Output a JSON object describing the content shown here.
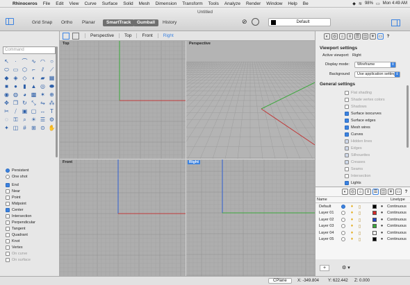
{
  "menubar": {
    "app": "Rhinoceros",
    "items": [
      "File",
      "Edit",
      "View",
      "Curve",
      "Surface",
      "Solid",
      "Mesh",
      "Dimension",
      "Transform",
      "Tools",
      "Analyze",
      "Render",
      "Window",
      "Help",
      "Be"
    ],
    "battery": "98%",
    "clock": "Mon 4:49 AM"
  },
  "window": {
    "title": "Untitled"
  },
  "toolbar": {
    "buttons": [
      "Grid Snap",
      "Ortho",
      "Planar",
      "SmartTrack",
      "Gumball",
      "History"
    ],
    "active": [
      "SmartTrack",
      "Gumball"
    ],
    "layer": "Default"
  },
  "command": {
    "placeholder": "Command"
  },
  "viewport_tabs": [
    "Perspective",
    "Top",
    "Front",
    "Right"
  ],
  "viewport_active": "Right",
  "viewports": [
    "Top",
    "Perspective",
    "Front",
    "Right"
  ],
  "osnap": {
    "mode": [
      {
        "label": "Persistent",
        "on": true
      },
      {
        "label": "One shot",
        "on": false
      }
    ],
    "items": [
      {
        "label": "End",
        "on": true
      },
      {
        "label": "Near",
        "on": false
      },
      {
        "label": "Point",
        "on": false
      },
      {
        "label": "Midpoint",
        "on": false
      },
      {
        "label": "Center",
        "on": true
      },
      {
        "label": "Intersection",
        "on": false
      },
      {
        "label": "Perpendicular",
        "on": false
      },
      {
        "label": "Tangent",
        "on": false
      },
      {
        "label": "Quadrant",
        "on": false
      },
      {
        "label": "Knot",
        "on": false
      },
      {
        "label": "Vertex",
        "on": false
      },
      {
        "label": "On curve",
        "on": false,
        "dim": true
      },
      {
        "label": "On surface",
        "on": false,
        "dim": true
      }
    ]
  },
  "viewport_settings": {
    "heading": "Viewport settings",
    "active_label": "Active viewport:",
    "active_value": "Right",
    "display_label": "Display mode:",
    "display_value": "Wireframe",
    "background_label": "Background",
    "background_value": "Use application settings"
  },
  "general_settings": {
    "heading": "General settings",
    "items": [
      {
        "label": "Flat shading",
        "on": false,
        "dim": true
      },
      {
        "label": "Shade vertex colors",
        "on": false,
        "dim": true
      },
      {
        "label": "Shadows",
        "on": false,
        "dim": true
      },
      {
        "label": "Surface isocurves",
        "on": true
      },
      {
        "label": "Surface edges",
        "on": true
      },
      {
        "label": "Mesh wires",
        "on": true
      },
      {
        "label": "Curves",
        "on": true
      },
      {
        "label": "Hidden lines",
        "on": true,
        "dim": true
      },
      {
        "label": "Edges",
        "on": true,
        "dim": true
      },
      {
        "label": "Silhouettes",
        "on": true,
        "dim": true
      },
      {
        "label": "Creases",
        "on": true,
        "dim": true
      },
      {
        "label": "Seams",
        "on": false,
        "dim": true
      },
      {
        "label": "Intersection",
        "on": false,
        "dim": true
      },
      {
        "label": "Lights",
        "on": true
      }
    ]
  },
  "layers": {
    "col_name": "Name",
    "col_linetype": "Linetype",
    "rows": [
      {
        "name": "Default",
        "color": "#000000",
        "current": true,
        "linetype": "Continuous"
      },
      {
        "name": "Layer 01",
        "color": "#d32a2a",
        "current": false,
        "linetype": "Continuous"
      },
      {
        "name": "Layer 02",
        "color": "#2446c8",
        "current": false,
        "linetype": "Continuous"
      },
      {
        "name": "Layer 03",
        "color": "#3aa83a",
        "current": false,
        "linetype": "Continuous"
      },
      {
        "name": "Layer 04",
        "color": "#ffffff",
        "current": false,
        "linetype": "Continuous"
      },
      {
        "name": "Layer 05",
        "color": "#000000",
        "current": false,
        "linetype": "Continuous"
      }
    ]
  },
  "status": {
    "cplane": "CPlane",
    "x": "X: -349.804",
    "y": "Y: 622.442",
    "z": "Z: 0.000"
  }
}
